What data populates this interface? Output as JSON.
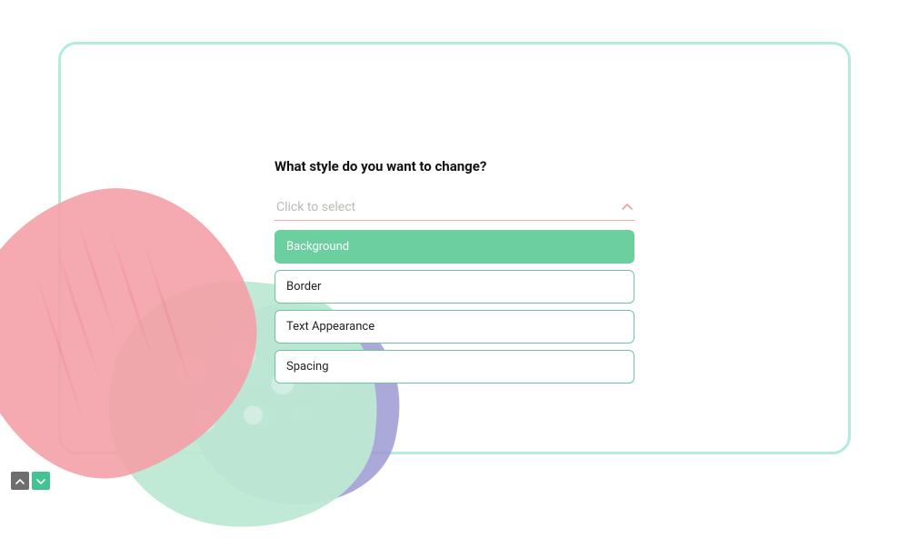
{
  "question": {
    "heading": "What style do you want to change?",
    "placeholder": "Click to select",
    "options": [
      {
        "label": "Background",
        "selected": true
      },
      {
        "label": "Border",
        "selected": false
      },
      {
        "label": "Text Appearance",
        "selected": false
      },
      {
        "label": "Spacing",
        "selected": false
      }
    ]
  },
  "colors": {
    "accent_green": "#6bcf9f",
    "accent_pink": "#f5a7af",
    "card_border": "#b5ecd6"
  }
}
